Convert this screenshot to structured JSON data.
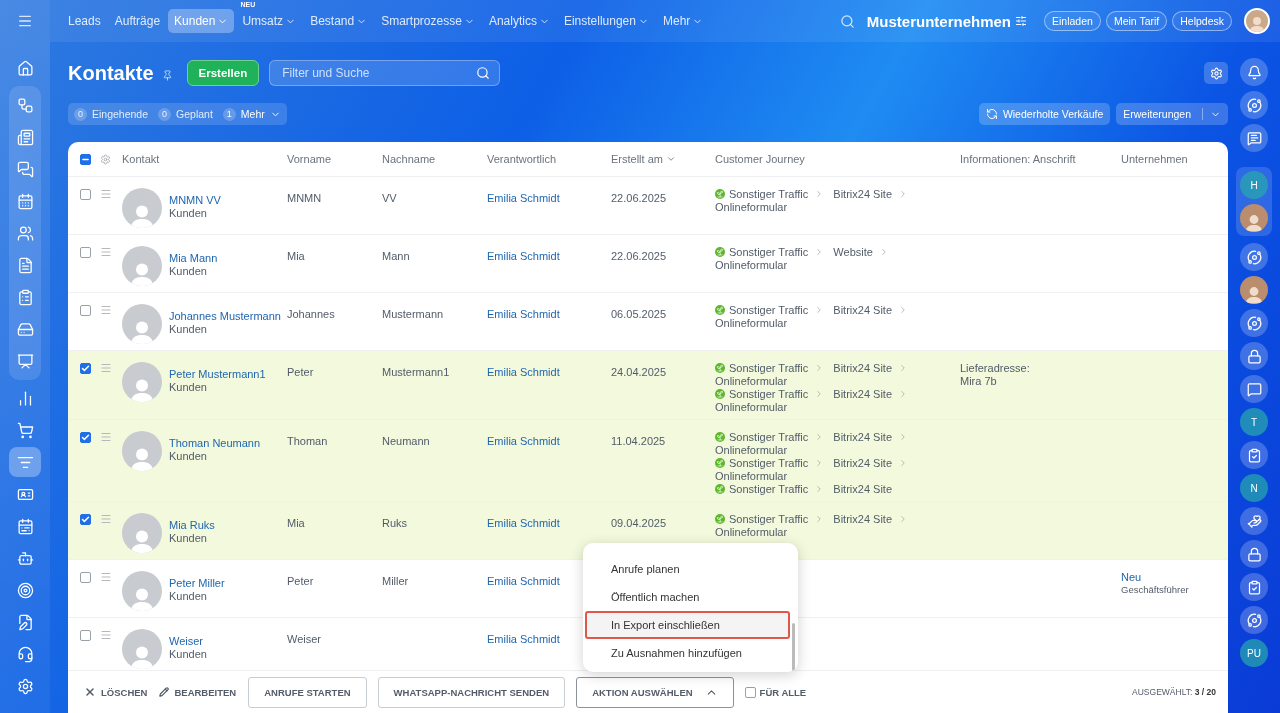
{
  "left_sidebar": {
    "top": [
      {
        "selected": false
      }
    ],
    "group": [
      {
        "selected": false
      },
      {
        "selected": false
      },
      {
        "selected": false
      },
      {
        "selected": false
      },
      {
        "selected": false
      },
      {
        "selected": false
      },
      {
        "selected": false
      },
      {
        "selected": false
      },
      {
        "selected": false
      }
    ],
    "bottom": [
      {
        "selected": false
      },
      {
        "selected": false
      },
      {
        "selected": true
      },
      {
        "selected": false
      },
      {
        "selected": false
      },
      {
        "selected": false
      },
      {
        "selected": false
      },
      {
        "selected": false
      },
      {
        "selected": false
      },
      {
        "selected": false
      }
    ]
  },
  "top_nav": {
    "items": [
      {
        "label": "Leads",
        "selected": false,
        "has_menu": false
      },
      {
        "label": "Aufträge",
        "selected": false,
        "has_menu": false
      },
      {
        "label": "Kunden",
        "selected": true,
        "has_menu": true
      },
      {
        "label": "Umsatz",
        "selected": false,
        "has_menu": true,
        "badge": "NEU"
      },
      {
        "label": "Bestand",
        "selected": false,
        "has_menu": true
      },
      {
        "label": "Smartprozesse",
        "selected": false,
        "has_menu": true
      },
      {
        "label": "Analytics",
        "selected": false,
        "has_menu": true
      },
      {
        "label": "Einstellungen",
        "selected": false,
        "has_menu": true
      },
      {
        "label": "Mehr",
        "selected": false,
        "has_menu": true
      }
    ],
    "company": "Musterunternehmen",
    "buttons": [
      "Einladen",
      "Mein Tarif",
      "Helpdesk"
    ]
  },
  "page": {
    "title": "Kontakte",
    "create_button": "Erstellen",
    "search": {
      "placeholder": "Filter und Suche"
    }
  },
  "counters": [
    {
      "count": "0",
      "label": "Eingehende",
      "has_menu": false
    },
    {
      "count": "0",
      "label": "Geplant",
      "has_menu": false
    },
    {
      "count": "1",
      "label": "Mehr",
      "has_menu": true
    }
  ],
  "repeat_sales_button": "Wiederholte Verkäufe",
  "extensions_button": "Erweiterungen",
  "table": {
    "select_all": {
      "checked": true,
      "indeterminate": true
    },
    "columns": [
      {
        "label": "Kontakt",
        "sorted": false
      },
      {
        "label": "Vorname",
        "sorted": false
      },
      {
        "label": "Nachname",
        "sorted": false
      },
      {
        "label": "Verantwortlich",
        "sorted": false
      },
      {
        "label": "Erstellt am",
        "sorted": true
      },
      {
        "label": "Customer Journey",
        "sorted": false
      },
      {
        "label": "Informationen: Anschrift",
        "sorted": false
      },
      {
        "label": "Unternehmen",
        "sorted": false
      }
    ],
    "rows": [
      {
        "selected": false,
        "name": "MNMN VV",
        "type": "Kunden",
        "first_name": "MNMN",
        "last_name": "VV",
        "responsible": "Emilia Schmidt",
        "created": "22.06.2025",
        "journeys": [
          [
            "Sonstiger Traffic",
            "Bitrix24 Site",
            "Onlineformular"
          ]
        ]
      },
      {
        "selected": false,
        "name": "Mia Mann",
        "type": "Kunden",
        "first_name": "Mia",
        "last_name": "Mann",
        "responsible": "Emilia Schmidt",
        "created": "22.06.2025",
        "journeys": [
          [
            "Sonstiger Traffic",
            "Website",
            "Onlineformular"
          ]
        ]
      },
      {
        "selected": false,
        "name": "Johannes Mustermann",
        "type": "Kunden",
        "first_name": "Johannes",
        "last_name": "Mustermann",
        "responsible": "Emilia Schmidt",
        "created": "06.05.2025",
        "journeys": [
          [
            "Sonstiger Traffic",
            "Bitrix24 Site",
            "Onlineformular"
          ]
        ]
      },
      {
        "selected": true,
        "name": "Peter Mustermann1",
        "type": "Kunden",
        "first_name": "Peter",
        "last_name": "Mustermann1",
        "responsible": "Emilia Schmidt",
        "created": "24.04.2025",
        "journeys": [
          [
            "Sonstiger Traffic",
            "Bitrix24 Site",
            "Onlineformular"
          ],
          [
            "Sonstiger Traffic",
            "Bitrix24 Site",
            "Onlineformular"
          ]
        ],
        "address": [
          "Lieferadresse:",
          "Mira 7b"
        ]
      },
      {
        "selected": true,
        "name": "Thoman Neumann",
        "type": "Kunden",
        "first_name": "Thoman",
        "last_name": "Neumann",
        "responsible": "Emilia Schmidt",
        "created": "11.04.2025",
        "journeys": [
          [
            "Sonstiger Traffic",
            "Bitrix24 Site",
            "Onlineformular"
          ],
          [
            "Sonstiger Traffic",
            "Bitrix24 Site",
            "Onlineformular"
          ],
          [
            "Sonstiger Traffic",
            "Bitrix24 Site"
          ]
        ]
      },
      {
        "selected": true,
        "name": "Mia Ruks",
        "type": "Kunden",
        "first_name": "Mia",
        "last_name": "Ruks",
        "responsible": "Emilia Schmidt",
        "created": "09.04.2025",
        "journeys": [
          [
            "Sonstiger Traffic",
            "Bitrix24 Site",
            "Onlineformular"
          ]
        ]
      },
      {
        "selected": false,
        "name": "Peter Miller",
        "type": "Kunden",
        "first_name": "Peter",
        "last_name": "Miller",
        "responsible": "Emilia Schmidt",
        "company": {
          "name": "Neu",
          "role": "Geschäftsführer"
        }
      },
      {
        "selected": false,
        "name": "Weiser",
        "type": "Kunden",
        "first_name": "Weiser",
        "responsible": "Emilia Schmidt"
      }
    ]
  },
  "action_menu": {
    "items": [
      {
        "label": "Anrufe planen",
        "highlighted": false
      },
      {
        "label": "Öffentlich machen",
        "highlighted": false
      },
      {
        "label": "In Export einschließen",
        "highlighted": true
      },
      {
        "label": "Zu Ausnahmen hinzufügen",
        "highlighted": false
      }
    ]
  },
  "action_bar": {
    "delete": "LÖSCHEN",
    "edit": "BEARBEITEN",
    "buttons": [
      "ANRUFE STARTEN",
      "WHATSAPP-NACHRICHT SENDEN"
    ],
    "action_select": "AKTION AUSWÄHLEN",
    "for_all": {
      "label": "FÜR ALLE",
      "checked": false
    },
    "selected_count": "AUSGEWÄHLT: **3 / 20**"
  },
  "right_sidebar": [
    {
      "kind": "icon"
    },
    {
      "kind": "icon"
    },
    {
      "kind": "icon"
    },
    {
      "kind": "letter",
      "label": "H",
      "group": true
    },
    {
      "kind": "photo",
      "group": true
    },
    {
      "kind": "icon"
    },
    {
      "kind": "photo"
    },
    {
      "kind": "icon"
    },
    {
      "kind": "icon"
    },
    {
      "kind": "icon"
    },
    {
      "kind": "letter",
      "label": "T"
    },
    {
      "kind": "icon"
    },
    {
      "kind": "letter",
      "label": "N"
    },
    {
      "kind": "icon"
    },
    {
      "kind": "icon"
    },
    {
      "kind": "icon"
    },
    {
      "kind": "icon"
    },
    {
      "kind": "letter",
      "label": "PU"
    }
  ]
}
